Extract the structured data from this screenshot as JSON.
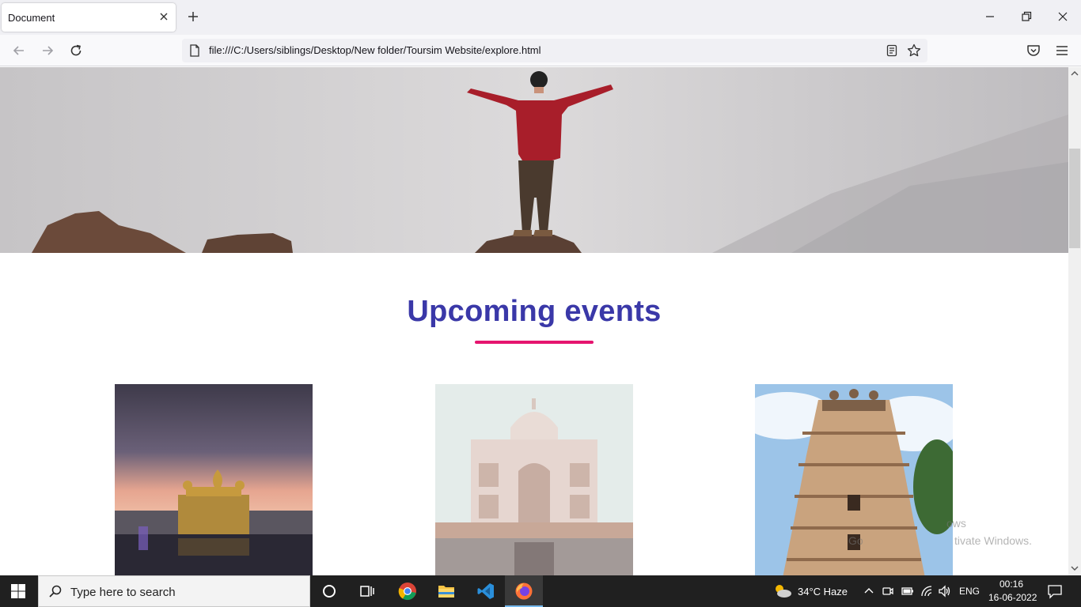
{
  "browser": {
    "tab_title": "Document",
    "url": "file:///C:/Users/siblings/Desktop/New folder/Toursim Website/explore.html"
  },
  "page": {
    "section_title": "Upcoming events",
    "colors": {
      "title": "#3a38a8",
      "underline": "#e5156f"
    },
    "cards": [
      {
        "image": "golden-temple-photo"
      },
      {
        "image": "taj-mahal-photo"
      },
      {
        "image": "dravidian-temple-photo"
      }
    ],
    "watermark_line1": "ows",
    "watermark_line2": "Go",
    "watermark_line3": "tivate Windows."
  },
  "taskbar": {
    "search_placeholder": "Type here to search",
    "weather": "34°C  Haze",
    "language": "ENG",
    "time": "00:16",
    "date": "16-06-2022"
  }
}
